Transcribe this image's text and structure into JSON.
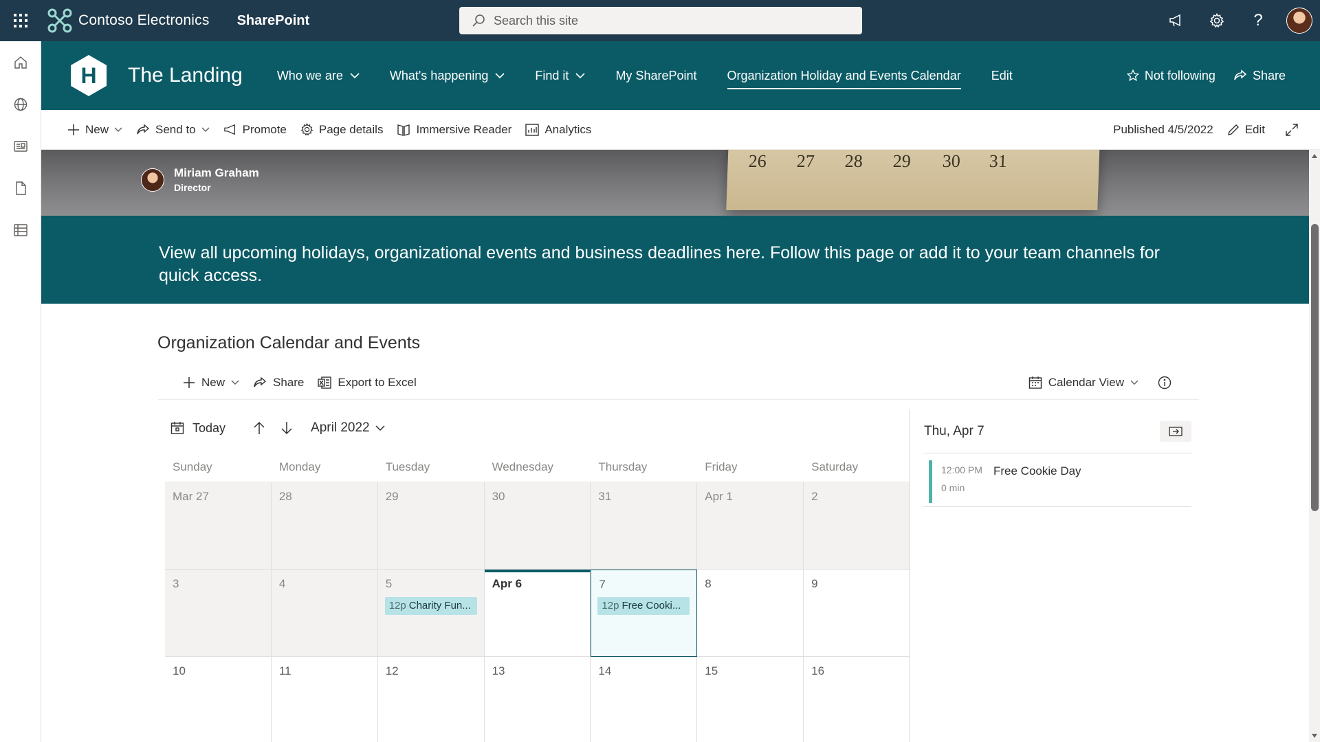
{
  "suite": {
    "brand": "Contoso Electronics",
    "app": "SharePoint",
    "search_placeholder": "Search this site"
  },
  "site": {
    "logo_letter": "H",
    "title": "The Landing",
    "nav": [
      {
        "label": "Who we are",
        "dropdown": true
      },
      {
        "label": "What's happening",
        "dropdown": true
      },
      {
        "label": "Find it",
        "dropdown": true
      },
      {
        "label": "My SharePoint",
        "dropdown": false
      },
      {
        "label": "Organization Holiday and Events Calendar",
        "dropdown": false,
        "active": true
      },
      {
        "label": "Edit",
        "dropdown": false
      }
    ],
    "follow_label": "Not following",
    "share_label": "Share"
  },
  "commands": {
    "new": "New",
    "send_to": "Send to",
    "promote": "Promote",
    "page_details": "Page details",
    "immersive_reader": "Immersive Reader",
    "analytics": "Analytics",
    "published": "Published 4/5/2022",
    "edit": "Edit"
  },
  "hero": {
    "calendar_numbers": [
      "26",
      "27",
      "28",
      "29",
      "30",
      "31"
    ],
    "author_name": "Miriam Graham",
    "author_role": "Director"
  },
  "banner": {
    "text": "View all upcoming holidays, organizational events and business deadlines here.  Follow this page or add it to your team channels for quick access."
  },
  "section": {
    "title": "Organization Calendar and Events"
  },
  "list_commands": {
    "new": "New",
    "share": "Share",
    "export": "Export to Excel",
    "view": "Calendar View"
  },
  "calendar": {
    "today_label": "Today",
    "month": "April 2022",
    "weekdays": [
      "Sunday",
      "Monday",
      "Tuesday",
      "Wednesday",
      "Thursday",
      "Friday",
      "Saturday"
    ],
    "weeks": [
      [
        {
          "d": "Mar 27"
        },
        {
          "d": "28"
        },
        {
          "d": "29"
        },
        {
          "d": "30"
        },
        {
          "d": "31"
        },
        {
          "d": "Apr 1"
        },
        {
          "d": "2"
        }
      ],
      [
        {
          "d": "3"
        },
        {
          "d": "4"
        },
        {
          "d": "5",
          "event": {
            "time": "12p",
            "title": "Charity Fun..."
          }
        },
        {
          "d": "Apr 6"
        },
        {
          "d": "7",
          "event": {
            "time": "12p",
            "title": "Free Cooki..."
          }
        },
        {
          "d": "8"
        },
        {
          "d": "9"
        }
      ],
      [
        {
          "d": "10"
        },
        {
          "d": "11"
        },
        {
          "d": "12"
        },
        {
          "d": "13"
        },
        {
          "d": "14"
        },
        {
          "d": "15"
        },
        {
          "d": "16"
        }
      ]
    ]
  },
  "agenda": {
    "date": "Thu, Apr 7",
    "items": [
      {
        "time": "12:00 PM",
        "title": "Free Cookie Day",
        "duration": "0 min"
      }
    ]
  },
  "colors": {
    "suite_bar": "#1f3a4d",
    "theme": "#0b5b66",
    "event_chip": "#b7e3e7",
    "agenda_bar": "#4fb3a9"
  }
}
